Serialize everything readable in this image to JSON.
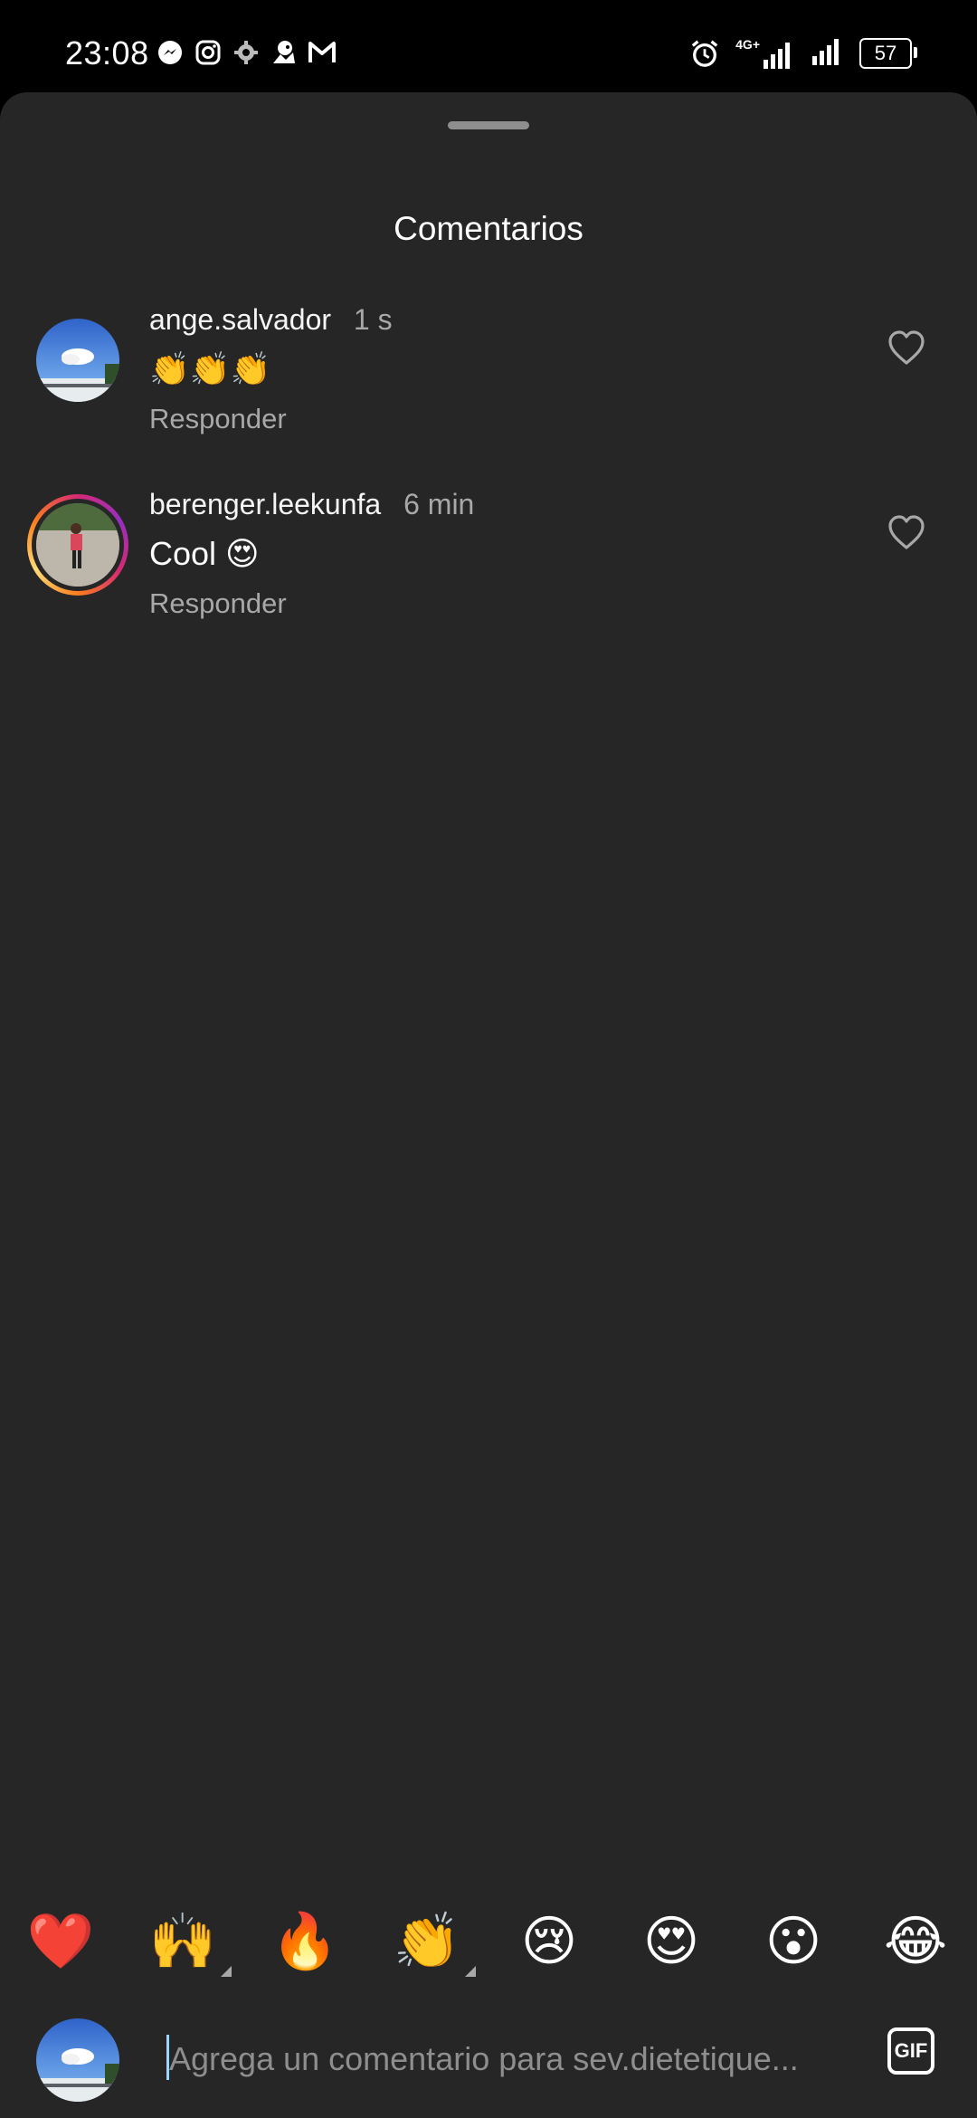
{
  "status_bar": {
    "time": "23:08",
    "left_icons": [
      "messenger-icon",
      "instagram-icon",
      "settings-icon",
      "app-icon",
      "gmail-icon"
    ],
    "right_icons": [
      "alarm-icon",
      "4g-signal-icon",
      "signal-icon"
    ],
    "network_label": "4G+",
    "battery": "57"
  },
  "sheet": {
    "title": "Comentarios"
  },
  "comments": [
    {
      "username": "ange.salvador",
      "time": "1 s",
      "text": "👏👏👏",
      "reply_label": "Responder"
    },
    {
      "username": "berenger.leekunfa",
      "time": "6 min",
      "text": "Cool 😍",
      "reply_label": "Responder"
    }
  ],
  "emoji_bar": [
    "❤️",
    "🙌",
    "🔥",
    "👏",
    "😢",
    "😍",
    "😮",
    "😂"
  ],
  "composer": {
    "placeholder": "Agrega un comentario para sev.dietetique...",
    "gif_label": "GIF"
  },
  "colors": {
    "sheet_bg": "#262626",
    "secondary_text": "#a8a8a8",
    "story_ring": "#d62976"
  }
}
